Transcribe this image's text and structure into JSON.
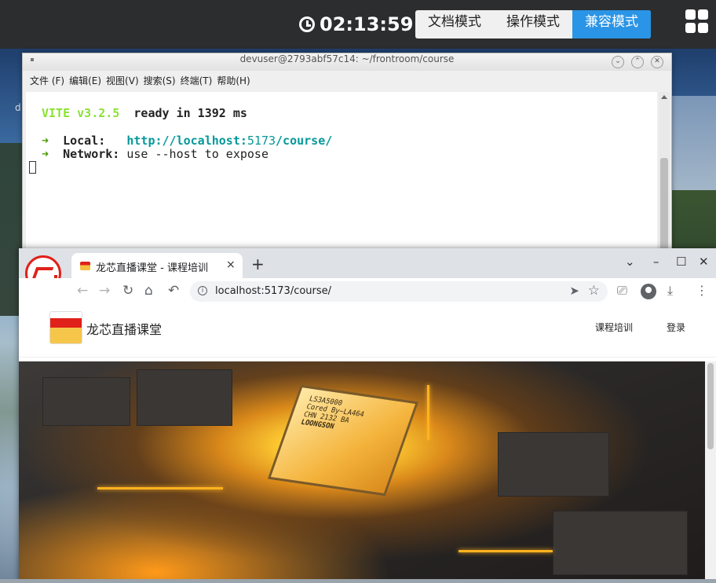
{
  "topbar": {
    "clock": "02:13:59",
    "modes": [
      "文档模式",
      "操作模式",
      "兼容模式"
    ],
    "active_mode": "兼容模式"
  },
  "desktop": {
    "icon_label_fragment": "d"
  },
  "terminal": {
    "title": "devuser@2793abf57c14: ~/frontroom/course",
    "menu": [
      "文件 (F)",
      "编辑(E)",
      "视图(V)",
      "搜索(S)",
      "终端(T)",
      "帮助(H)"
    ],
    "lines": {
      "vite_name": "VITE v3.2.5",
      "ready": "ready in 1392 ms",
      "arrow": "➜",
      "local_label": "Local:",
      "local_url_prefix": "http://localhost:",
      "local_url_port": "5173",
      "local_url_suffix": "/course/",
      "network_label": "Network:",
      "network_text": "use --host to expose"
    }
  },
  "browser": {
    "tab_title": "龙芯直播课堂 - 课程培训",
    "tab_close": "×",
    "new_tab": "+",
    "url": "localhost:5173/course/",
    "window_controls": [
      "⌄",
      "–",
      "☐",
      "✕"
    ]
  },
  "site": {
    "name": "龙芯直播课堂",
    "nav": [
      "课程培训",
      "登录"
    ],
    "hero_chip_text": [
      "LS3A5000",
      "Cored By~LA464",
      "CHN 2132 BA",
      "LOONGSON"
    ]
  },
  "colors": {
    "accent": "#2a94e6",
    "brand_red": "#e0201a",
    "terminal_green": "#4e9a06",
    "terminal_cyan": "#06989a"
  }
}
